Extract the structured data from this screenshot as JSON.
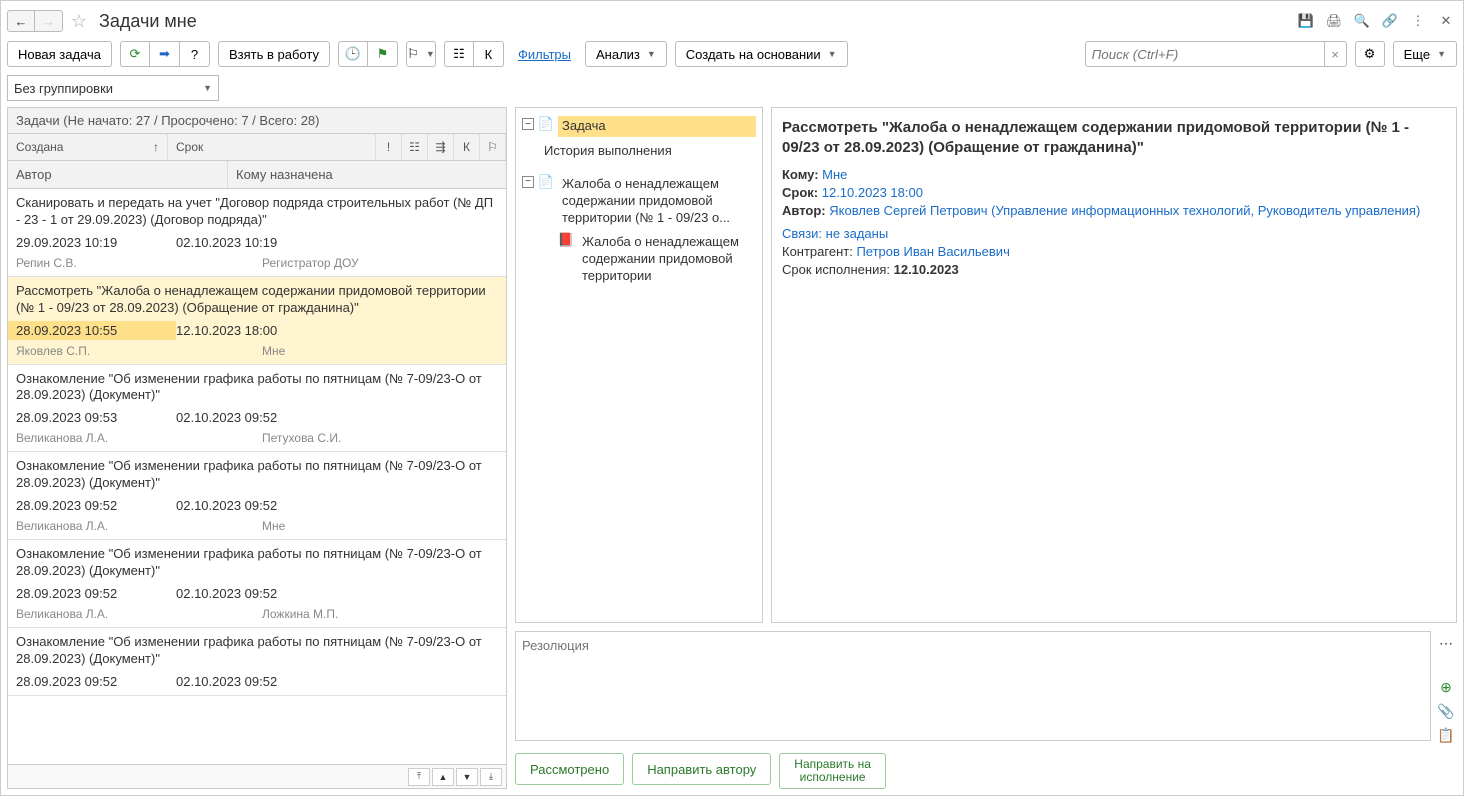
{
  "title": "Задачи мне",
  "toolbar": {
    "new_task": "Новая задача",
    "take_work": "Взять в работу",
    "filters": "Фильтры",
    "analysis": "Анализ",
    "create_based": "Создать на основании",
    "search_placeholder": "Поиск (Ctrl+F)",
    "more": "Еще"
  },
  "grouping": "Без группировки",
  "tasks_summary": "Задачи (Не начато: 27 / Просрочено: 7 / Всего: 28)",
  "columns": {
    "created": "Создана",
    "due": "Срок",
    "author": "Автор",
    "assignee": "Кому назначена"
  },
  "tasks": [
    {
      "title": "Сканировать и передать на учет \"Договор подряда строительных работ (№ ДП - 23 - 1 от 29.09.2023) (Договор подряда)\"",
      "created": "29.09.2023 10:19",
      "due": "02.10.2023 10:19",
      "author": "Репин С.В.",
      "assignee": "Регистратор ДОУ",
      "selected": false
    },
    {
      "title": "Рассмотреть \"Жалоба о ненадлежащем содержании придомовой территории (№ 1 - 09/23 от 28.09.2023) (Обращение от гражданина)\"",
      "created": "28.09.2023 10:55",
      "due": "12.10.2023 18:00",
      "author": "Яковлев С.П.",
      "assignee": "Мне",
      "selected": true
    },
    {
      "title": "Ознакомление \"Об изменении графика работы по пятницам (№ 7-09/23-О от 28.09.2023) (Документ)\"",
      "created": "28.09.2023 09:53",
      "due": "02.10.2023 09:52",
      "author": "Великанова Л.А.",
      "assignee": "Петухова С.И.",
      "selected": false
    },
    {
      "title": "Ознакомление \"Об изменении графика работы по пятницам (№ 7-09/23-О от 28.09.2023) (Документ)\"",
      "created": "28.09.2023 09:52",
      "due": "02.10.2023 09:52",
      "author": "Великанова Л.А.",
      "assignee": "Мне",
      "selected": false
    },
    {
      "title": "Ознакомление \"Об изменении графика работы по пятницам (№ 7-09/23-О от 28.09.2023) (Документ)\"",
      "created": "28.09.2023 09:52",
      "due": "02.10.2023 09:52",
      "author": "Великанова Л.А.",
      "assignee": "Ложкина М.П.",
      "selected": false
    },
    {
      "title": "Ознакомление \"Об изменении графика работы по пятницам (№ 7-09/23-О от 28.09.2023) (Документ)\"",
      "created": "28.09.2023 09:52",
      "due": "02.10.2023 09:52",
      "author": "",
      "assignee": "",
      "selected": false
    }
  ],
  "tree": {
    "task_label": "Задача",
    "history_label": "История выполнения",
    "doc_label": "Жалоба о ненадлежащем содержании придомовой территории (№ 1 - 09/23 о...",
    "pdf_label": "Жалоба о ненадлежащем содержании придомовой территории"
  },
  "detail": {
    "title": "Рассмотреть \"Жалоба о ненадлежащем содержании придомовой территории (№ 1 - 09/23 от 28.09.2023) (Обращение от гражданина)\"",
    "to_label": "Кому:",
    "to_value": "Мне",
    "due_label": "Срок:",
    "due_value": "12.10.2023 18:00",
    "author_label": "Автор:",
    "author_value": "Яковлев Сергей Петрович (Управление информационных технологий, Руководитель управления)",
    "links_label": "Связи: не заданы",
    "contractor_label": "Контрагент:",
    "contractor_value": "Петров Иван Васильевич",
    "exec_due_label": "Срок исполнения:",
    "exec_due_value": "12.10.2023"
  },
  "resolution_placeholder": "Резолюция",
  "actions": {
    "reviewed": "Рассмотрено",
    "send_author": "Направить автору",
    "send_exec_1": "Направить на",
    "send_exec_2": "исполнение"
  }
}
